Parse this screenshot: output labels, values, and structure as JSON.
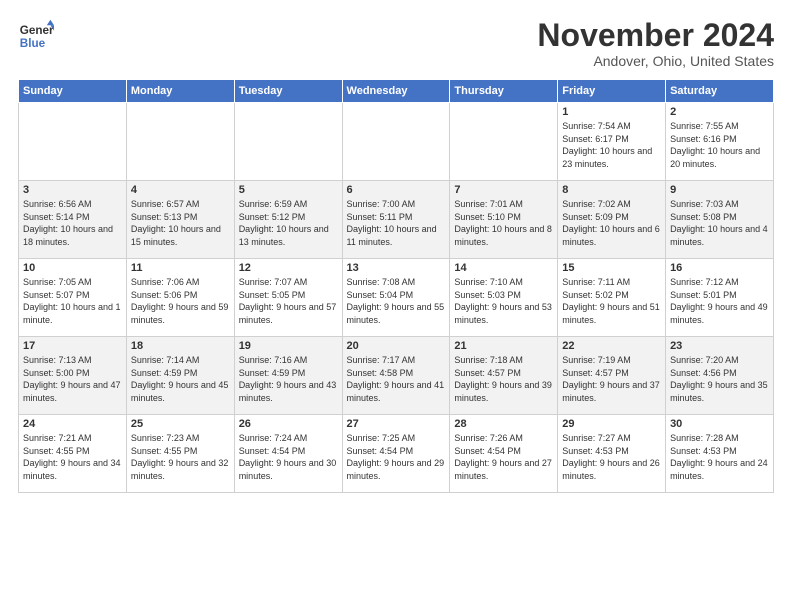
{
  "header": {
    "logo_line1": "General",
    "logo_line2": "Blue",
    "month": "November 2024",
    "location": "Andover, Ohio, United States"
  },
  "weekdays": [
    "Sunday",
    "Monday",
    "Tuesday",
    "Wednesday",
    "Thursday",
    "Friday",
    "Saturday"
  ],
  "weeks": [
    [
      {
        "day": "",
        "info": ""
      },
      {
        "day": "",
        "info": ""
      },
      {
        "day": "",
        "info": ""
      },
      {
        "day": "",
        "info": ""
      },
      {
        "day": "",
        "info": ""
      },
      {
        "day": "1",
        "info": "Sunrise: 7:54 AM\nSunset: 6:17 PM\nDaylight: 10 hours and 23 minutes."
      },
      {
        "day": "2",
        "info": "Sunrise: 7:55 AM\nSunset: 6:16 PM\nDaylight: 10 hours and 20 minutes."
      }
    ],
    [
      {
        "day": "3",
        "info": "Sunrise: 6:56 AM\nSunset: 5:14 PM\nDaylight: 10 hours and 18 minutes."
      },
      {
        "day": "4",
        "info": "Sunrise: 6:57 AM\nSunset: 5:13 PM\nDaylight: 10 hours and 15 minutes."
      },
      {
        "day": "5",
        "info": "Sunrise: 6:59 AM\nSunset: 5:12 PM\nDaylight: 10 hours and 13 minutes."
      },
      {
        "day": "6",
        "info": "Sunrise: 7:00 AM\nSunset: 5:11 PM\nDaylight: 10 hours and 11 minutes."
      },
      {
        "day": "7",
        "info": "Sunrise: 7:01 AM\nSunset: 5:10 PM\nDaylight: 10 hours and 8 minutes."
      },
      {
        "day": "8",
        "info": "Sunrise: 7:02 AM\nSunset: 5:09 PM\nDaylight: 10 hours and 6 minutes."
      },
      {
        "day": "9",
        "info": "Sunrise: 7:03 AM\nSunset: 5:08 PM\nDaylight: 10 hours and 4 minutes."
      }
    ],
    [
      {
        "day": "10",
        "info": "Sunrise: 7:05 AM\nSunset: 5:07 PM\nDaylight: 10 hours and 1 minute."
      },
      {
        "day": "11",
        "info": "Sunrise: 7:06 AM\nSunset: 5:06 PM\nDaylight: 9 hours and 59 minutes."
      },
      {
        "day": "12",
        "info": "Sunrise: 7:07 AM\nSunset: 5:05 PM\nDaylight: 9 hours and 57 minutes."
      },
      {
        "day": "13",
        "info": "Sunrise: 7:08 AM\nSunset: 5:04 PM\nDaylight: 9 hours and 55 minutes."
      },
      {
        "day": "14",
        "info": "Sunrise: 7:10 AM\nSunset: 5:03 PM\nDaylight: 9 hours and 53 minutes."
      },
      {
        "day": "15",
        "info": "Sunrise: 7:11 AM\nSunset: 5:02 PM\nDaylight: 9 hours and 51 minutes."
      },
      {
        "day": "16",
        "info": "Sunrise: 7:12 AM\nSunset: 5:01 PM\nDaylight: 9 hours and 49 minutes."
      }
    ],
    [
      {
        "day": "17",
        "info": "Sunrise: 7:13 AM\nSunset: 5:00 PM\nDaylight: 9 hours and 47 minutes."
      },
      {
        "day": "18",
        "info": "Sunrise: 7:14 AM\nSunset: 4:59 PM\nDaylight: 9 hours and 45 minutes."
      },
      {
        "day": "19",
        "info": "Sunrise: 7:16 AM\nSunset: 4:59 PM\nDaylight: 9 hours and 43 minutes."
      },
      {
        "day": "20",
        "info": "Sunrise: 7:17 AM\nSunset: 4:58 PM\nDaylight: 9 hours and 41 minutes."
      },
      {
        "day": "21",
        "info": "Sunrise: 7:18 AM\nSunset: 4:57 PM\nDaylight: 9 hours and 39 minutes."
      },
      {
        "day": "22",
        "info": "Sunrise: 7:19 AM\nSunset: 4:57 PM\nDaylight: 9 hours and 37 minutes."
      },
      {
        "day": "23",
        "info": "Sunrise: 7:20 AM\nSunset: 4:56 PM\nDaylight: 9 hours and 35 minutes."
      }
    ],
    [
      {
        "day": "24",
        "info": "Sunrise: 7:21 AM\nSunset: 4:55 PM\nDaylight: 9 hours and 34 minutes."
      },
      {
        "day": "25",
        "info": "Sunrise: 7:23 AM\nSunset: 4:55 PM\nDaylight: 9 hours and 32 minutes."
      },
      {
        "day": "26",
        "info": "Sunrise: 7:24 AM\nSunset: 4:54 PM\nDaylight: 9 hours and 30 minutes."
      },
      {
        "day": "27",
        "info": "Sunrise: 7:25 AM\nSunset: 4:54 PM\nDaylight: 9 hours and 29 minutes."
      },
      {
        "day": "28",
        "info": "Sunrise: 7:26 AM\nSunset: 4:54 PM\nDaylight: 9 hours and 27 minutes."
      },
      {
        "day": "29",
        "info": "Sunrise: 7:27 AM\nSunset: 4:53 PM\nDaylight: 9 hours and 26 minutes."
      },
      {
        "day": "30",
        "info": "Sunrise: 7:28 AM\nSunset: 4:53 PM\nDaylight: 9 hours and 24 minutes."
      }
    ]
  ]
}
